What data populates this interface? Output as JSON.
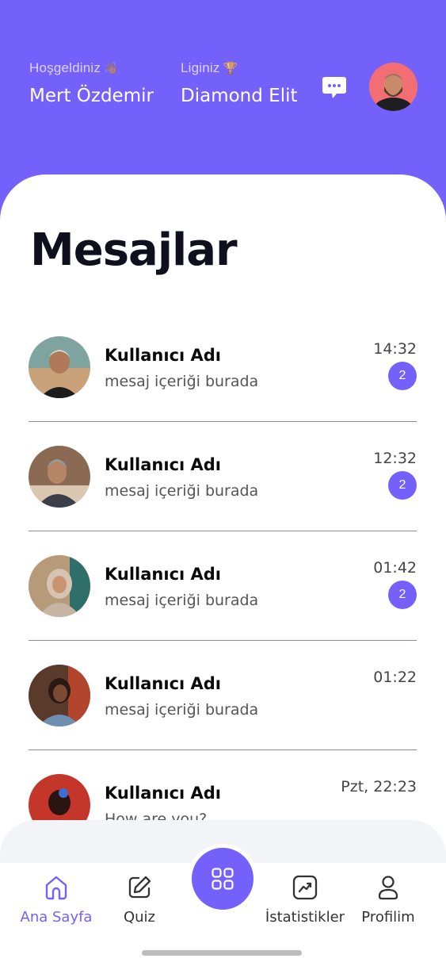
{
  "header": {
    "welcome_label": "Hoşgeldiniz",
    "welcome_emoji": "👋🏽",
    "user_name": "Mert Özdemir",
    "league_label": "Liginiz",
    "league_emoji": "🏆",
    "league_value": "Diamond Elit",
    "chat_icon": "chat-bubble-icon",
    "avatar_icon": "user-avatar"
  },
  "page": {
    "title": "Mesajlar"
  },
  "messages": [
    {
      "name": "Kullanıcı Adı",
      "text": "mesaj içeriği burada",
      "time": "14:32",
      "unread": "2"
    },
    {
      "name": "Kullanıcı Adı",
      "text": "mesaj içeriği burada",
      "time": "12:32",
      "unread": "2"
    },
    {
      "name": "Kullanıcı Adı",
      "text": "mesaj içeriği burada",
      "time": "01:42",
      "unread": "2"
    },
    {
      "name": "Kullanıcı Adı",
      "text": "mesaj içeriği burada",
      "time": "01:22"
    },
    {
      "name": "Kullanıcı Adı",
      "text": "How are you?",
      "time": "Pzt, 22:23"
    }
  ],
  "nav": {
    "home": "Ana Sayfa",
    "quiz": "Quiz",
    "center_icon": "grid-icon",
    "stats": "İstatistikler",
    "profile": "Profilim"
  },
  "colors": {
    "accent": "#7461fb",
    "badge": "#7461fb",
    "avatar_bg": "#f26e73"
  }
}
